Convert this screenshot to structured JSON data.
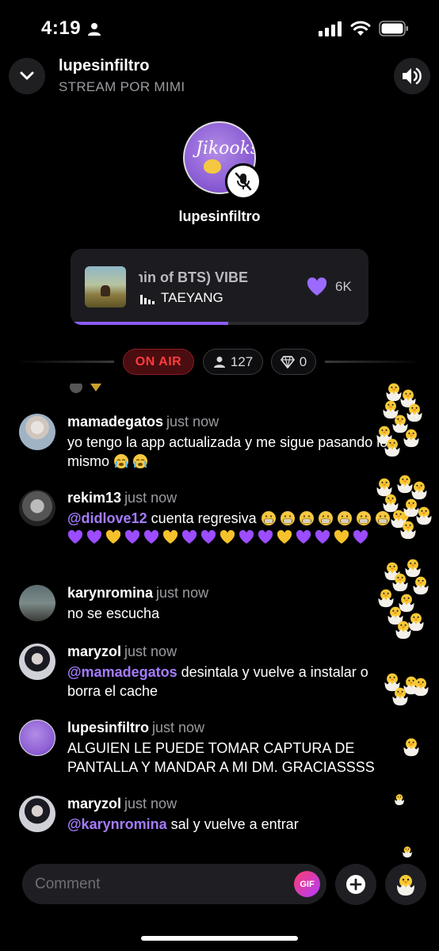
{
  "status_bar": {
    "time": "4:19"
  },
  "header": {
    "title": "lupesinfiltro",
    "subtitle": "STREAM POR MIMI"
  },
  "host": {
    "name": "lupesinfiltro",
    "avatar_text": "Jikooks"
  },
  "music": {
    "track": "min of BTS)    VIBE",
    "artist": "TAEYANG",
    "likes": "6K",
    "progress_fraction": 0.53
  },
  "live": {
    "status_label": "ON AIR",
    "viewers": "127",
    "diamonds": "0"
  },
  "chat": [
    {
      "user": "mamadegatos",
      "time": "just now",
      "text": "yo tengo la app actualizada y me sigue pasando lo mismo"
    },
    {
      "user": "rekim13",
      "time": "just now",
      "mention": "@didlove12",
      "text": " cuenta regresiva"
    },
    {
      "user": "karynromina",
      "time": "just now",
      "text": "no se escucha"
    },
    {
      "user": "maryzol",
      "time": "just now",
      "mention": "@mamadegatos",
      "text": " desintala y vuelve a instalar o borra el cache"
    },
    {
      "user": "lupesinfiltro",
      "time": "just now",
      "text": "ALGUIEN LE PUEDE TOMAR CAPTURA DE PANTALLA Y MANDAR A MI DM. GRACIASSSS"
    },
    {
      "user": "maryzol",
      "time": "just now",
      "mention": "@karynromina",
      "text": " sal y vuelve a entrar"
    }
  ],
  "composer": {
    "placeholder": "Comment",
    "gif_label": "GIF"
  },
  "colors": {
    "accent": "#8a5cf6",
    "mention": "#a57cff",
    "on_air": "#ff3b3b",
    "background": "#000000"
  },
  "icons": [
    "person-icon",
    "signal-icon",
    "wifi-icon",
    "battery-icon",
    "chevron-down-icon",
    "speaker-icon",
    "mic-off-icon",
    "equalizer-icon",
    "heart-icon",
    "person-icon",
    "diamond-icon",
    "plus-icon",
    "hatching-chick-icon"
  ]
}
